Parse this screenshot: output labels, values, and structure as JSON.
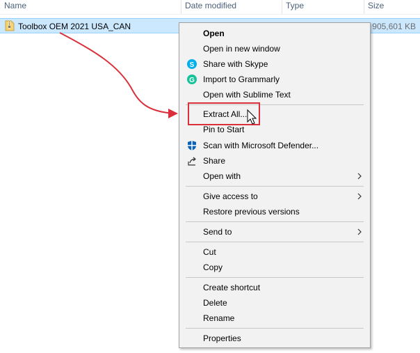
{
  "columns": {
    "name": "Name",
    "date_modified": "Date modified",
    "type": "Type",
    "size": "Size"
  },
  "file": {
    "name": "Toolbox OEM 2021 USA_CAN",
    "size": "905,601 KB",
    "icon": "zip-folder-icon"
  },
  "menu": {
    "open": "Open",
    "open_new_window": "Open in new window",
    "share_skype": "Share with Skype",
    "import_grammarly": "Import to Grammarly",
    "open_sublime": "Open with Sublime Text",
    "extract_all": "Extract All...",
    "pin_to_start": "Pin to Start",
    "scan_defender": "Scan with Microsoft Defender...",
    "share": "Share",
    "open_with": "Open with",
    "give_access": "Give access to",
    "restore_previous": "Restore previous versions",
    "send_to": "Send to",
    "cut": "Cut",
    "copy": "Copy",
    "create_shortcut": "Create shortcut",
    "delete": "Delete",
    "rename": "Rename",
    "properties": "Properties"
  },
  "colors": {
    "selection": "#cce8ff",
    "menu_bg": "#f2f2f2",
    "annotation": "#d9303b",
    "skype": "#00aff0",
    "grammarly": "#15c39a",
    "defender": "#0a63b8"
  }
}
